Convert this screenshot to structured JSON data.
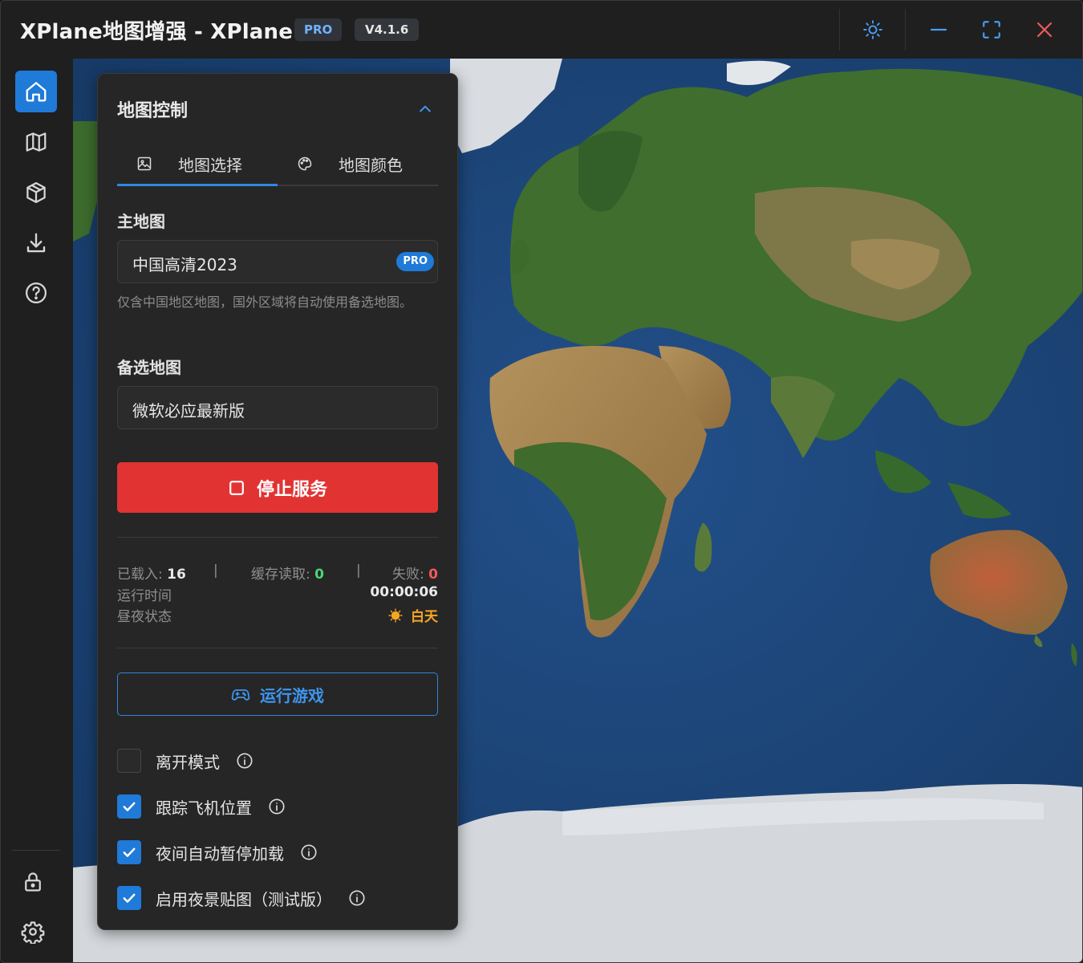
{
  "titlebar": {
    "title": "XPlane地图增强 - XPlane",
    "pro_badge": "PRO",
    "version": "V4.1.6"
  },
  "sidebar": {
    "items": [
      {
        "icon": "home-icon",
        "active": true
      },
      {
        "icon": "map-icon",
        "active": false
      },
      {
        "icon": "cube-icon",
        "active": false
      },
      {
        "icon": "download-icon",
        "active": false
      },
      {
        "icon": "help-icon",
        "active": false
      }
    ],
    "bottom": [
      {
        "icon": "lock-icon"
      },
      {
        "icon": "gear-icon"
      }
    ]
  },
  "panel": {
    "title": "地图控制",
    "tabs": [
      {
        "label": "地图选择",
        "icon": "image-icon",
        "active": true
      },
      {
        "label": "地图颜色",
        "icon": "palette-icon",
        "active": false
      }
    ],
    "main_map_label": "主地图",
    "main_map_value": "中国高清2023",
    "main_map_badge": "PRO",
    "hint": "仅含中国地区地图，国外区域将自动使用备选地图。",
    "backup_map_label": "备选地图",
    "backup_map_value": "微软必应最新版",
    "stop_button": "停止服务",
    "stats": {
      "loaded_label": "已载入:",
      "loaded_value": "16",
      "sep": "|",
      "cache_label": "缓存读取:",
      "cache_value": "0",
      "failed_label": "失败:",
      "failed_value": "0",
      "runtime_label": "运行时间",
      "runtime_value": "00:00:06",
      "daynight_label": "昼夜状态",
      "daynight_value": "白天"
    },
    "run_button": "运行游戏",
    "options": [
      {
        "label": "离开模式",
        "checked": false
      },
      {
        "label": "跟踪飞机位置",
        "checked": true
      },
      {
        "label": "夜间自动暂停加载",
        "checked": true
      },
      {
        "label": "启用夜景贴图（测试版）",
        "checked": true
      }
    ]
  },
  "colors": {
    "accent": "#1f7ad8",
    "danger": "#e23333",
    "success": "#4cd47b",
    "warning": "#f5a623"
  }
}
